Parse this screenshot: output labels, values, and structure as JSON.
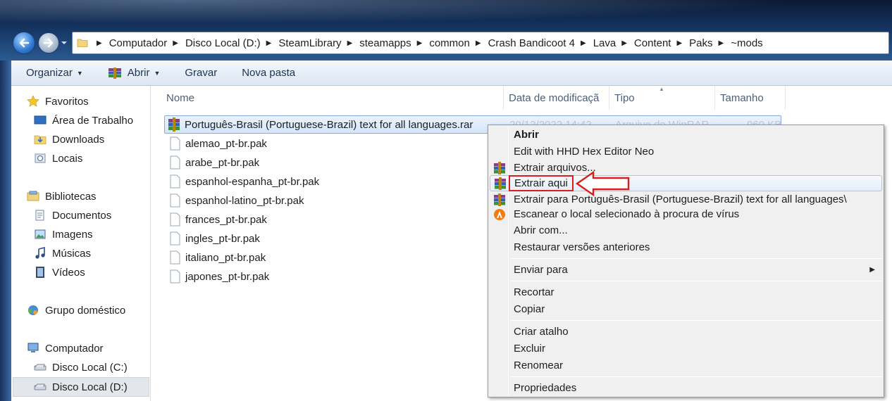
{
  "address_bar": {
    "crumbs": [
      "Computador",
      "Disco Local (D:)",
      "SteamLibrary",
      "steamapps",
      "common",
      "Crash Bandicoot 4",
      "Lava",
      "Content",
      "Paks",
      "~mods"
    ]
  },
  "toolbar": {
    "organize_label": "Organizar",
    "extract_label": "Abrir",
    "burn_label": "Gravar",
    "new_folder_label": "Nova pasta"
  },
  "nav_pane": {
    "favorites": {
      "label": "Favoritos",
      "items": [
        "Área de Trabalho",
        "Downloads",
        "Locais"
      ]
    },
    "libraries": {
      "label": "Bibliotecas",
      "items": [
        "Documentos",
        "Imagens",
        "Músicas",
        "Vídeos"
      ]
    },
    "homegroup": {
      "label": "Grupo doméstico"
    },
    "computer": {
      "label": "Computador",
      "items": [
        "Disco Local (C:)",
        "Disco Local (D:)"
      ]
    }
  },
  "file_list": {
    "columns": [
      "Nome",
      "Data de modificaçã",
      "Tipo",
      "Tamanho"
    ],
    "selected_row": {
      "name": "Português-Brasil (Portuguese-Brazil) text for all languages.rar",
      "date": "20/12/2022 14:42",
      "type": "Arquivo do WinRAR",
      "size": "960 KB"
    },
    "files": [
      "alemao_pt-br.pak",
      "arabe_pt-br.pak",
      "espanhol-espanha_pt-br.pak",
      "espanhol-latino_pt-br.pak",
      "frances_pt-br.pak",
      "ingles_pt-br.pak",
      "italiano_pt-br.pak",
      "japones_pt-br.pak"
    ]
  },
  "context_menu": {
    "items": [
      {
        "label": "Abrir",
        "icon": "none"
      },
      {
        "label": "Edit with HHD Hex Editor Neo",
        "icon": "none"
      },
      {
        "label": "Extrair arquivos...",
        "icon": "winrar-icon"
      },
      {
        "label": "Extrair aqui",
        "icon": "winrar-icon"
      },
      {
        "label": "Extrair para Português-Brasil (Portuguese-Brazil) text for all languages\\",
        "icon": "winrar-icon"
      },
      {
        "label": "Escanear o local selecionado à procura de vírus",
        "icon": "avast-icon"
      },
      {
        "label": "Abrir com...",
        "icon": "none"
      },
      {
        "label": "Restaurar versões anteriores",
        "icon": "none"
      },
      {
        "label": "Enviar para",
        "icon": "none"
      },
      {
        "label": "Recortar",
        "icon": "none"
      },
      {
        "label": "Copiar",
        "icon": "none"
      },
      {
        "label": "Criar atalho",
        "icon": "none"
      },
      {
        "label": "Excluir",
        "icon": "none"
      },
      {
        "label": "Renomear",
        "icon": "none"
      },
      {
        "label": "Propriedades",
        "icon": "none"
      }
    ],
    "highlighted": "Extrair aqui"
  },
  "colors": {
    "highlight_red": "#d81e1e",
    "selection_blue": "#84acdd",
    "frame_dark": "#14335f"
  }
}
